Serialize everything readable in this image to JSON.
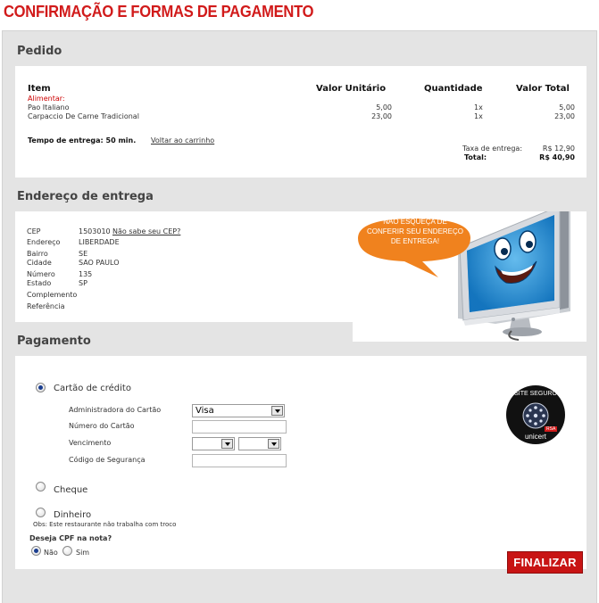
{
  "page": {
    "title": "CONFIRMAÇÃO E FORMAS DE PAGAMENTO"
  },
  "order": {
    "section_title": "Pedido",
    "headers": {
      "item": "Item",
      "unit_price": "Valor Unitário",
      "quantity": "Quantidade",
      "total": "Valor Total"
    },
    "category": "Alimentar:",
    "items": [
      {
        "name": "Pao Italiano",
        "unit_price": "5,00",
        "quantity": "1x",
        "total": "5,00"
      },
      {
        "name": "Carpaccio De Carne Tradicional",
        "unit_price": "23,00",
        "quantity": "1x",
        "total": "23,00"
      }
    ],
    "delivery_time": "Tempo de entrega: 50 min.",
    "back_to_cart": "Voltar ao carrinho",
    "delivery_fee_label": "Taxa de entrega:",
    "delivery_fee_value": "R$ 12,90",
    "total_label": "Total:",
    "total_value": "R$ 40,90"
  },
  "address": {
    "section_title": "Endereço de entrega",
    "cep_label": "CEP",
    "cep_value": "1503010",
    "cep_link": "Não sabe seu CEP?",
    "street_label": "Endereço",
    "street_value": "LIBERDADE",
    "district_label": "Bairro",
    "district_value": "SE",
    "city_label": "Cidade",
    "city_value": "SAO PAULO",
    "number_label": "Número",
    "number_value": "135",
    "state_label": "Estado",
    "state_value": "SP",
    "complement_label": "Complemento",
    "reference_label": "Referência",
    "bubble_text": "NÃO ESQUEÇA DE CONFERIR SEU ENDEREÇO DE ENTREGA!"
  },
  "payment": {
    "section_title": "Pagamento",
    "credit_card_label": "Cartão de crédito",
    "card_admin_label": "Administradora do Cartão",
    "card_admin_value": "Visa",
    "card_number_label": "Número do Cartão",
    "expiry_label": "Vencimento",
    "security_code_label": "Código de Segurança",
    "check_label": "Cheque",
    "cash_label": "Dinheiro",
    "cash_note": "Obs: Este restaurante não trabalha com troco",
    "cpf_question": "Deseja CPF na nota?",
    "cpf_no": "Não",
    "cpf_yes": "Sim",
    "seal_text": "SITE SEGURO",
    "seal_brand": "unicert",
    "seal_rsa": "RSA"
  },
  "actions": {
    "finalize_label": "FINALIZAR"
  },
  "colors": {
    "title_red": "#d11a1a",
    "button_red": "#c81414",
    "bubble_orange": "#f0821e",
    "panel_gray": "#e4e4e4"
  }
}
